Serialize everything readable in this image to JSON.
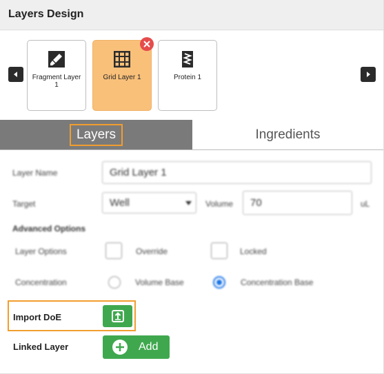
{
  "header": {
    "title": "Layers Design"
  },
  "layers": [
    {
      "label": "Fragment Layer 1",
      "icon": "paintbrush-icon",
      "selected": false
    },
    {
      "label": "Grid Layer 1",
      "icon": "grid-icon",
      "selected": true
    },
    {
      "label": "Protein 1",
      "icon": "protein-icon",
      "selected": false
    }
  ],
  "tabs": {
    "active": "Layers",
    "inactive": "Ingredients"
  },
  "form": {
    "layer_name_label": "Layer Name",
    "layer_name_value": "Grid Layer 1",
    "target_label": "Target",
    "target_value": "Well",
    "volume_label": "Volume",
    "volume_value": "70",
    "volume_unit": "uL",
    "advanced_heading": "Advanced Options",
    "layer_options_label": "Layer Options",
    "override_label": "Override",
    "locked_label": "Locked",
    "concentration_label": "Concentration",
    "volume_base_label": "Volume Base",
    "concentration_base_label": "Concentration Base",
    "concentration_selected": "Concentration Base"
  },
  "import": {
    "label": "Import DoE"
  },
  "linked": {
    "label": "Linked Layer",
    "add_label": "Add"
  },
  "colors": {
    "selected_card": "#f9c07a",
    "accent_orange": "#f29d2e",
    "green": "#3fa84e",
    "tab_active_bg": "#7a7a7a",
    "close_red": "#e64c4c"
  }
}
